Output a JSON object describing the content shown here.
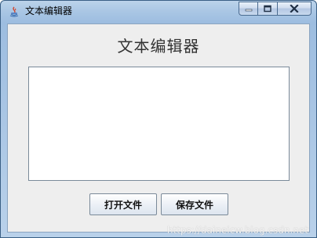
{
  "window": {
    "title": "文本编辑器"
  },
  "caption_buttons": {
    "minimize_icon": "minimize-icon",
    "maximize_icon": "maximize-icon",
    "close_icon": "close-icon"
  },
  "main": {
    "heading": "文本编辑器",
    "editor": {
      "value": "",
      "placeholder": ""
    },
    "buttons": {
      "open_label": "打开文件",
      "save_label": "保存文件"
    }
  },
  "watermark": "https://daineicw.blog.csdn.net",
  "colors": {
    "titlebar": "#a9c6e4",
    "client_bg": "#eeeeee",
    "text_area_bg": "#ffffff",
    "border": "#3a5f85"
  }
}
